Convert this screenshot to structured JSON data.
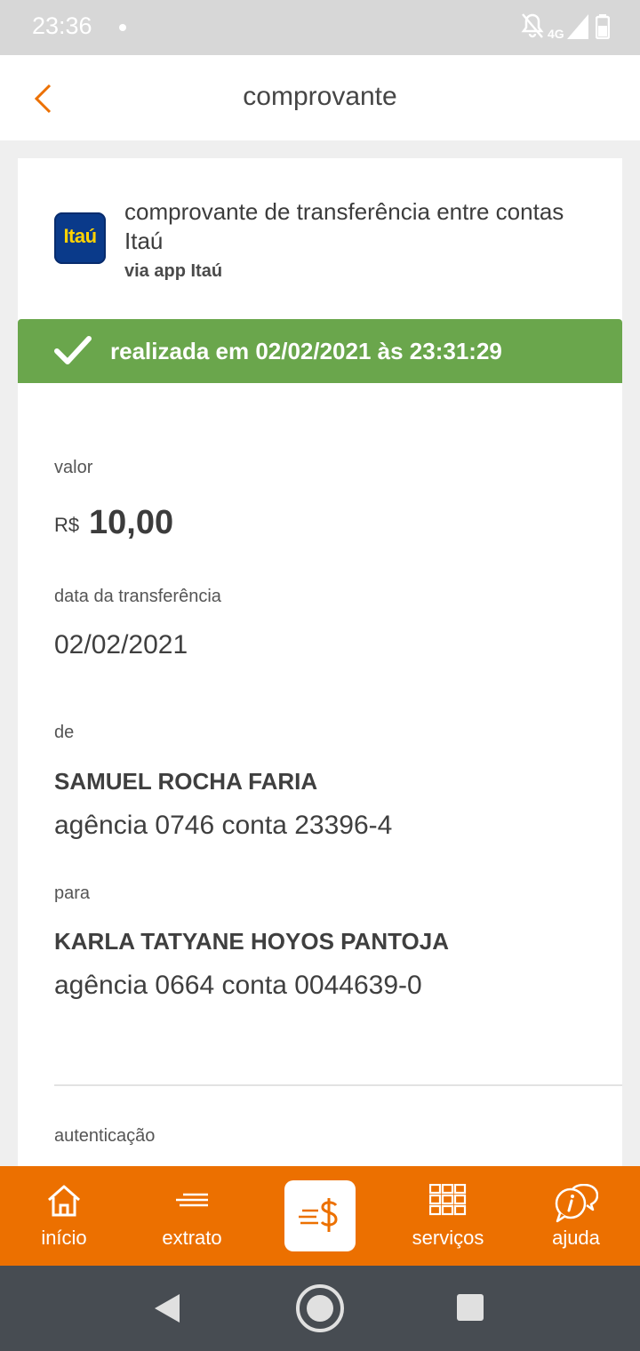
{
  "status_bar": {
    "time": "23:36",
    "network": "4G",
    "icons": [
      "notifications-off-icon",
      "signal-icon",
      "battery-icon"
    ]
  },
  "header": {
    "title": "comprovante",
    "back_icon": "chevron-left-icon"
  },
  "receipt": {
    "logo_text": "Itaú",
    "title": "comprovante de transferência entre contas Itaú",
    "subtitle": "via app Itaú",
    "status_text": "realizada em 02/02/2021 às 23:31:29",
    "amount_label": "valor",
    "currency": "R$",
    "amount": "10,00",
    "date_label": "data da transferência",
    "date": "02/02/2021",
    "from_label": "de",
    "from_name": "SAMUEL ROCHA FARIA",
    "from_account": "agência 0746 conta 23396-4",
    "to_label": "para",
    "to_name": "KARLA TATYANE HOYOS PANTOJA",
    "to_account": "agência 0664 conta 0044639-0",
    "auth_label": "autenticação"
  },
  "bottom_nav": {
    "items": [
      {
        "label": "início",
        "icon": "home-icon"
      },
      {
        "label": "extrato",
        "icon": "statement-icon"
      },
      {
        "label": "",
        "icon": "transfer-money-icon"
      },
      {
        "label": "serviços",
        "icon": "grid-icon"
      },
      {
        "label": "ajuda",
        "icon": "help-chat-icon"
      }
    ]
  },
  "colors": {
    "brand_orange": "#ec7000",
    "success_green": "#6aa64c",
    "itau_blue": "#0a3a8a",
    "itau_yellow": "#ffd200"
  }
}
